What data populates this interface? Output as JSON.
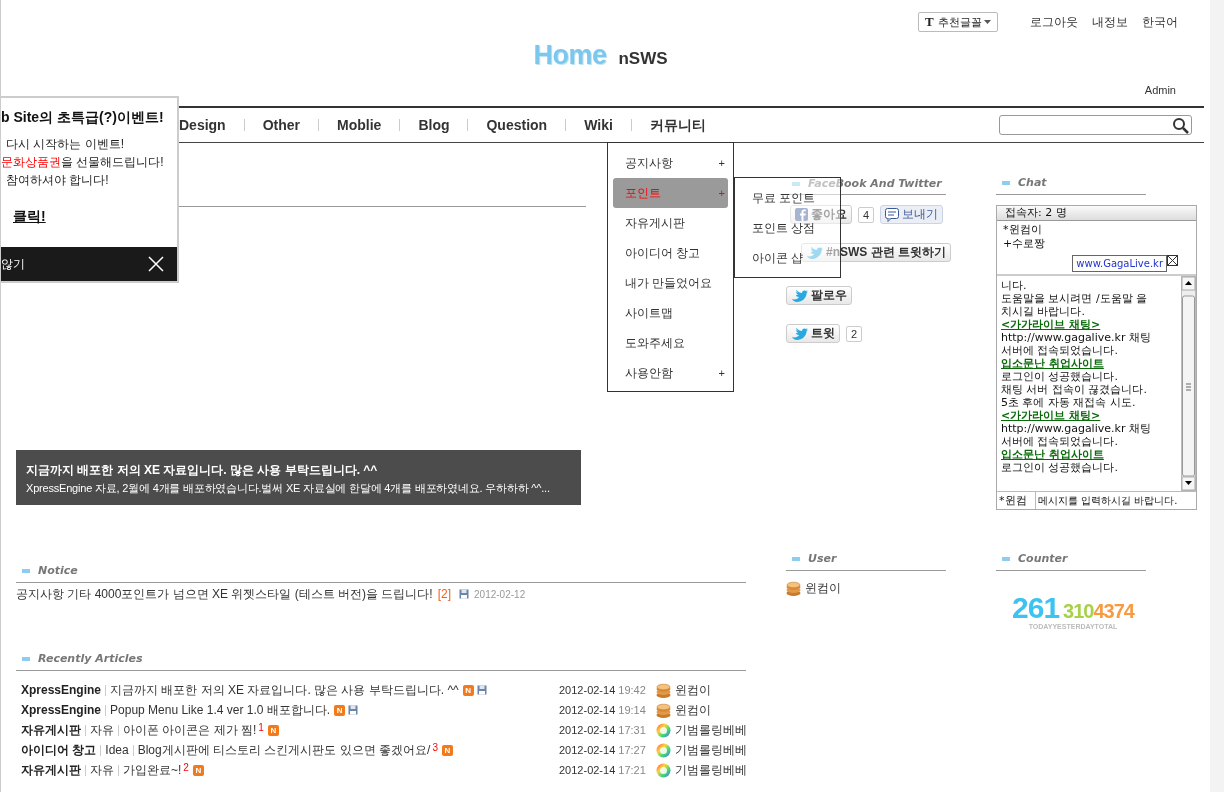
{
  "top_bar": {
    "font_selector": {
      "icon_letter": "T",
      "label": "추천글꼴"
    },
    "links": [
      "로그아웃",
      "내정보",
      "한국어"
    ]
  },
  "logo": {
    "title": "Home",
    "subtitle": "nSWS"
  },
  "admin_link": "Admin",
  "nav": {
    "items": [
      "Design",
      "Other",
      "Moblie",
      "Blog",
      "Question",
      "Wiki",
      "커뮤니티"
    ]
  },
  "community_menu": {
    "items": [
      {
        "label": "공지사항",
        "marker": "+",
        "selected": false
      },
      {
        "label": "포인트",
        "marker": "+",
        "selected": true
      },
      {
        "label": "자유게시판",
        "selected": false
      },
      {
        "label": "아이디어 창고",
        "selected": false
      },
      {
        "label": "내가 만들었어요",
        "selected": false
      },
      {
        "label": "사이트맵",
        "selected": false
      },
      {
        "label": "도와주세요",
        "selected": false
      },
      {
        "label": "사용안함",
        "marker": "+",
        "selected": false
      }
    ],
    "submenu": [
      "무료 포인트",
      "포인트 상점",
      "아이콘 샵"
    ]
  },
  "event_popup": {
    "title": "b Site의 초특급(?)이벤트!",
    "lines": [
      [
        {
          "text": "다시 시작하는 이벤트!",
          "highlight": false
        }
      ],
      [
        {
          "text": "문화상품권",
          "highlight": true
        },
        {
          "text": "을 선물해드립니다!",
          "highlight": false
        }
      ],
      [
        {
          "text": "참여하셔야 합니다!",
          "highlight": false
        }
      ]
    ],
    "link": "클릭!",
    "footer": "않기"
  },
  "featured_post": {
    "title": "지금까지 배포한 저의 XE 자료입니다. 많은 사용 부탁드립니다. ^^",
    "summary": "XpressEngine 자료, 2월에 4개를 배포하였습니다.벌써 XE 자료실에 한달에 4개를 배포하였네요. 우하하하 ^^..."
  },
  "social": {
    "title": "FaceBook And Twitter",
    "like_button": "좋아요",
    "like_count": "4",
    "send_button": "보내기",
    "hashtag_button": "#nSWS 관련 트윗하기",
    "follow_button": "팔로우",
    "tweet_button": "트윗",
    "tweet_count": "2"
  },
  "chat": {
    "title": "Chat",
    "user_count": "접속자: 2 명",
    "users": [
      "*윈컴이",
      "+수로짱"
    ],
    "site_badge": "www.GagaLive.kr",
    "log": [
      {
        "kind": "text",
        "text": "니다."
      },
      {
        "kind": "text",
        "text": "도움말을 보시려면 /도움말 을 치시길 바랍니다."
      },
      {
        "kind": "link",
        "text": "<가가라이브 채팅>"
      },
      {
        "kind": "text",
        "text": "http://www.gagalive.kr 채팅 서버에 접속되었습니다."
      },
      {
        "kind": "link",
        "text": "입소문난 취업사이트"
      },
      {
        "kind": "text",
        "text": "로그인이 성공했습니다."
      },
      {
        "kind": "text",
        "text": "채팅 서버 접속이 끊겼습니다."
      },
      {
        "kind": "text",
        "text": "5초 후에 자동 재접속 시도."
      },
      {
        "kind": "link",
        "text": "<가가라이브 채팅>"
      },
      {
        "kind": "text",
        "text": "http://www.gagalive.kr 채팅 서버에 접속되었습니다."
      },
      {
        "kind": "link",
        "text": "입소문난 취업사이트"
      },
      {
        "kind": "text",
        "text": "로그인이 성공했습니다."
      }
    ],
    "name_field": "*윈컴",
    "placeholder": "메시지를 입력하시길 바랍니다."
  },
  "notice": {
    "title": "Notice",
    "items": [
      {
        "text": "공지사항 기타 4000포인트가 넘으면 XE 위젯스타일 (테스트 버전)을 드립니다!",
        "comments": "[2]",
        "attachment": true,
        "date": "2012-02-12"
      }
    ]
  },
  "recent": {
    "title": "Recently Articles",
    "rows": [
      {
        "board": "XpressEngine",
        "title": "지금까지 배포한 저의 XE 자료입니다. 많은 사용 부탁드립니다. ^^",
        "new_badge": "N",
        "attachment": true,
        "date": "2012-02-14",
        "time": "19:42",
        "author": "윈컴이",
        "avatar": {
          "kind": "coins"
        }
      },
      {
        "board": "XpressEngine",
        "title": "Popup Menu Like 1.4 ver 1.0 배포합니다.",
        "new_badge": "N",
        "attachment": true,
        "date": "2012-02-14",
        "time": "19:14",
        "author": "윈컴이",
        "avatar": {
          "kind": "coins"
        }
      },
      {
        "board": "자유게시판",
        "category": "자유",
        "title": "아이폰 아이콘은 제가 찜!",
        "comments": "1",
        "new_badge": "N",
        "attachment": false,
        "date": "2012-02-14",
        "time": "17:31",
        "author": "기범롤링베베",
        "avatar": {
          "kind": "wheel"
        }
      },
      {
        "board": "아이디어 창고",
        "category": "Idea",
        "title": "Blog게시판에 티스토리 스킨게시판도 있으면 좋겠어요/",
        "comments": "3",
        "new_badge": "N",
        "attachment": false,
        "date": "2012-02-14",
        "time": "17:27",
        "author": "기범롤링베베",
        "avatar": {
          "kind": "wheel"
        }
      },
      {
        "board": "자유게시판",
        "category": "자유",
        "title": "가입완료~!",
        "comments": "2",
        "new_badge": "N",
        "attachment": false,
        "date": "2012-02-14",
        "time": "17:21",
        "author": "기범롤링베베",
        "avatar": {
          "kind": "wheel"
        }
      }
    ]
  },
  "user": {
    "title": "User",
    "users": [
      {
        "name": "윈컴이",
        "avatar": {
          "kind": "coins"
        }
      }
    ]
  },
  "counter": {
    "title": "Counter",
    "today": "261",
    "yesterday": "310",
    "total": "4374",
    "labels": [
      "TODAY",
      "YESTERDAY",
      "TOTAL"
    ]
  }
}
